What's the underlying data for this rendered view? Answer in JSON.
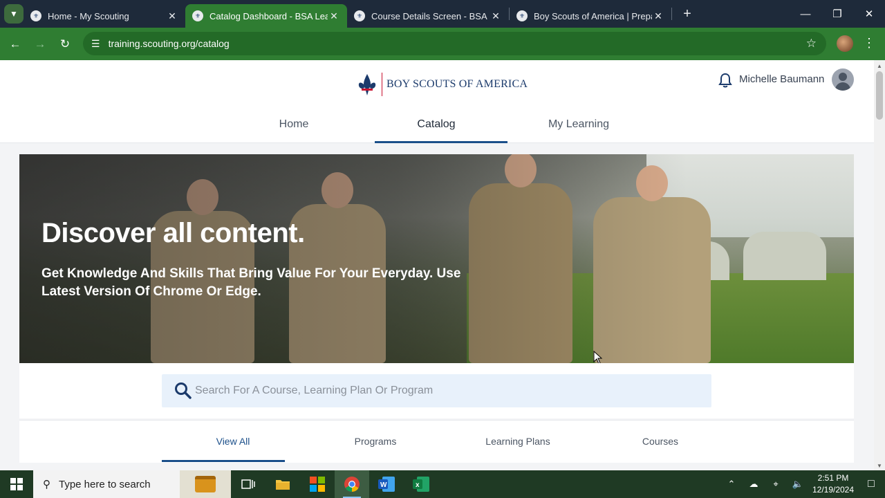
{
  "browser": {
    "tabs": [
      {
        "title": "Home - My Scouting",
        "active": false
      },
      {
        "title": "Catalog Dashboard - BSA Learn",
        "active": true
      },
      {
        "title": "Course Details Screen - BSA Lea",
        "active": false
      },
      {
        "title": "Boy Scouts of America | Prepar",
        "active": false
      }
    ],
    "url": "training.scouting.org/catalog"
  },
  "header": {
    "brand": "BOY SCOUTS OF AMERICA",
    "user_name": "Michelle Baumann",
    "nav": [
      {
        "label": "Home",
        "active": false
      },
      {
        "label": "Catalog",
        "active": true
      },
      {
        "label": "My Learning",
        "active": false
      }
    ]
  },
  "hero": {
    "title": "Discover all content.",
    "subtitle": "Get Knowledge And Skills That Bring Value For Your Everyday. Use Latest Version Of Chrome Or Edge."
  },
  "search": {
    "placeholder": "Search For A Course, Learning Plan Or Program",
    "value": ""
  },
  "filters": [
    {
      "label": "View All",
      "active": true
    },
    {
      "label": "Programs",
      "active": false
    },
    {
      "label": "Learning Plans",
      "active": false
    },
    {
      "label": "Courses",
      "active": false
    }
  ],
  "taskbar": {
    "search_text": "Type here to search",
    "time": "2:51 PM",
    "date": "12/19/2024"
  },
  "colors": {
    "browser_green": "#2f7d32",
    "brand_blue": "#1b4f8a",
    "brand_red": "#c8102e"
  }
}
